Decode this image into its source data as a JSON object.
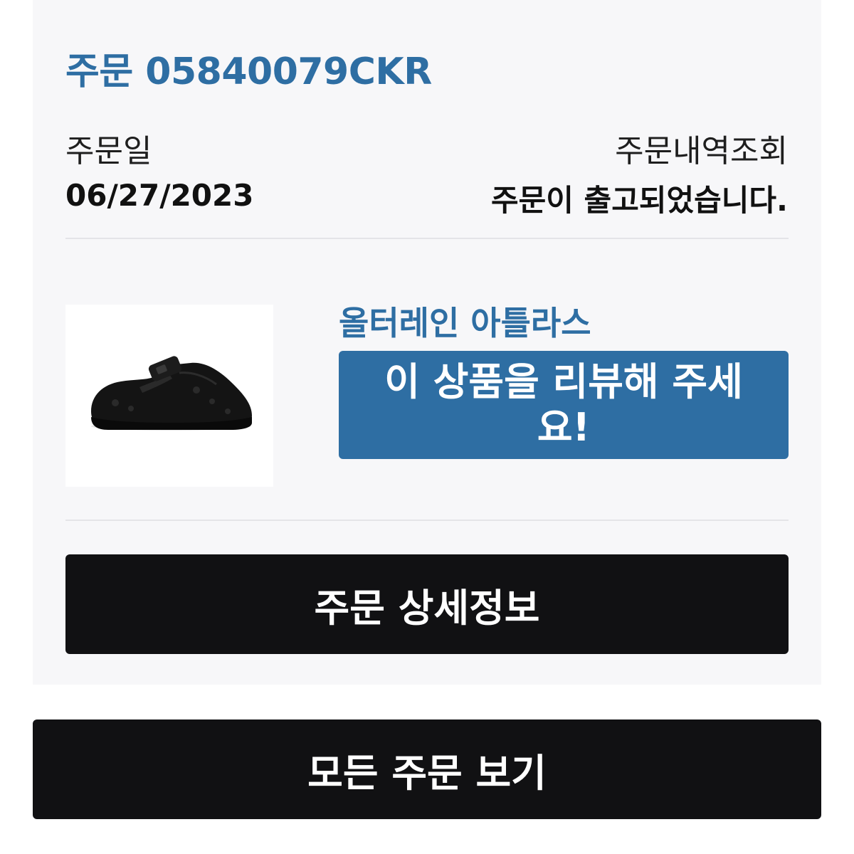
{
  "order": {
    "title": "주문 05840079CKR",
    "date_label": "주문일",
    "date_value": "06/27/2023",
    "status_label": "주문내역조회",
    "status_value": "주문이 출고되었습니다."
  },
  "product": {
    "name": "올터레인 아틀라스",
    "image_icon": "clog-shoe-image",
    "review_button_label": "이 상품을 리뷰해 주세요!"
  },
  "buttons": {
    "order_detail_label": "주문 상세정보",
    "all_orders_label": "모든 주문 보기"
  },
  "colors": {
    "accent": "#2e6ea3",
    "dark_button": "#111113",
    "card_background": "#f7f7f9"
  }
}
